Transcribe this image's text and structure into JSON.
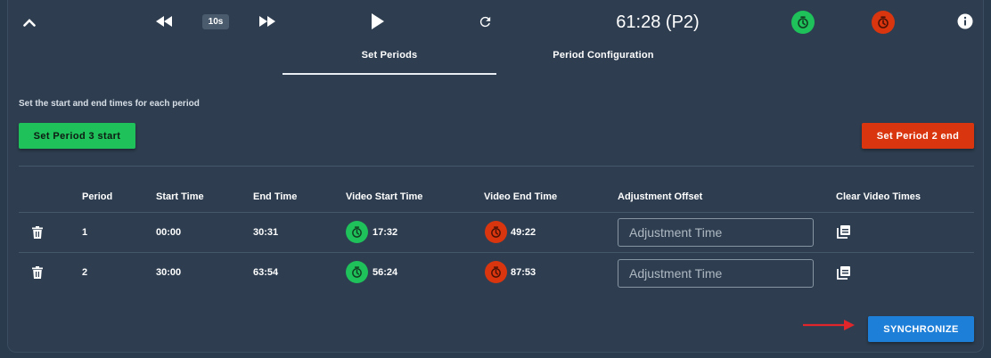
{
  "controls": {
    "skip_label": "10s",
    "clock": "61:28 (P2)"
  },
  "tabs": [
    {
      "label": "Set Periods",
      "active": true
    },
    {
      "label": "Period Configuration",
      "active": false
    }
  ],
  "instructions": "Set the start and end times for each period",
  "buttons": {
    "set_start": "Set Period 3 start",
    "set_end": "Set Period 2 end",
    "synchronize": "SYNCHRONIZE"
  },
  "table": {
    "headers": [
      "Period",
      "Start Time",
      "End Time",
      "Video Start Time",
      "Video End Time",
      "Adjustment Offset",
      "Clear Video Times"
    ],
    "rows": [
      {
        "period": "1",
        "start": "00:00",
        "end": "30:31",
        "video_start": "17:32",
        "video_end": "49:22",
        "adjustment_placeholder": "Adjustment Time",
        "adjustment_value": ""
      },
      {
        "period": "2",
        "start": "30:00",
        "end": "63:54",
        "video_start": "56:24",
        "video_end": "87:53",
        "adjustment_placeholder": "Adjustment Time",
        "adjustment_value": ""
      }
    ]
  },
  "colors": {
    "background": "#2e3e50",
    "start_green": "#1ec15a",
    "end_red": "#d9360f",
    "sync_blue": "#1e7fd8",
    "annotation_arrow": "#e0262b"
  },
  "icons": {
    "collapse": "chevron-up-icon",
    "rewind": "rewind-icon",
    "forward": "fast-forward-icon",
    "play": "play-icon",
    "refresh": "refresh-icon",
    "video_start": "timer-start-icon",
    "video_end": "timer-stop-icon",
    "info": "info-icon",
    "delete": "trash-icon",
    "clear": "clear-video-times-icon"
  }
}
